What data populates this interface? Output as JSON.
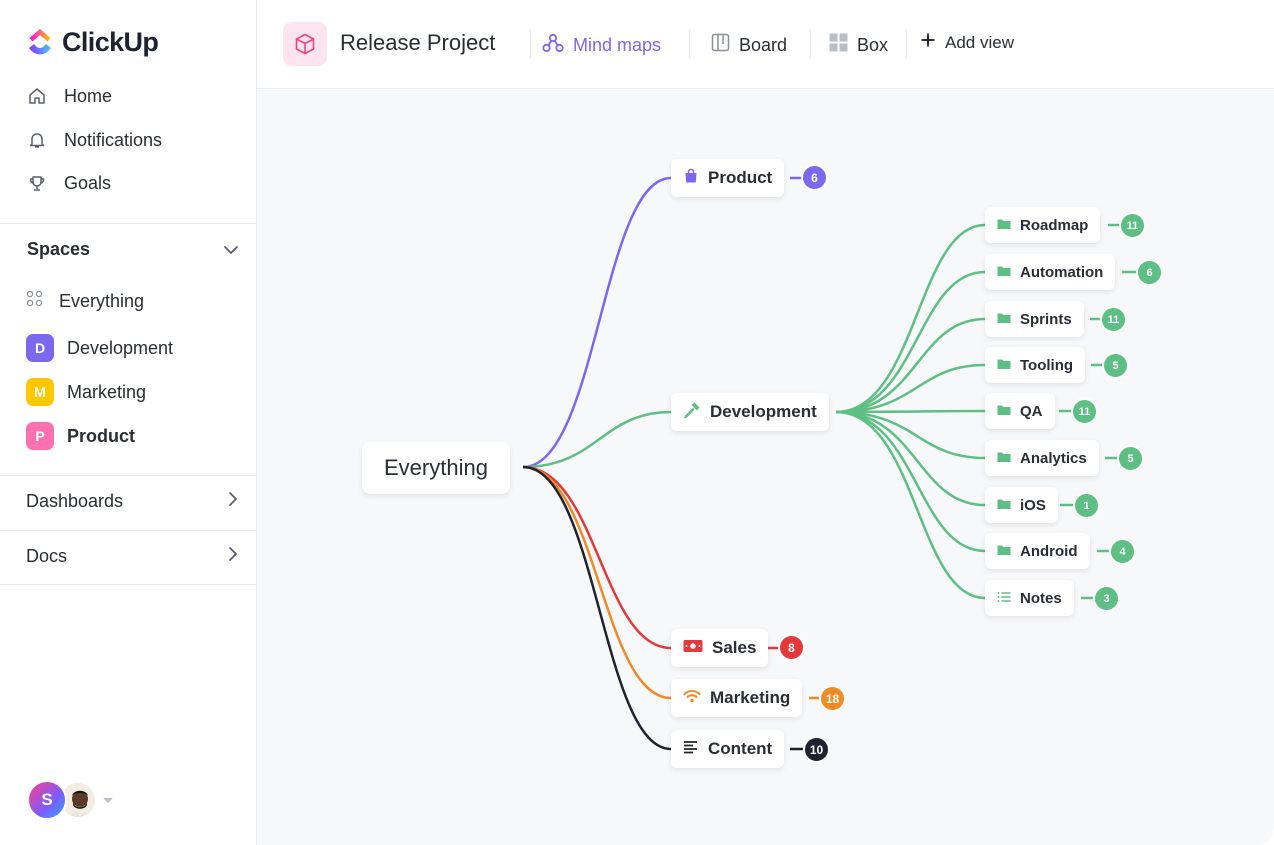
{
  "app": {
    "name": "ClickUp"
  },
  "sidebar": {
    "nav": [
      {
        "label": "Home",
        "icon": "home-icon"
      },
      {
        "label": "Notifications",
        "icon": "bell-icon"
      },
      {
        "label": "Goals",
        "icon": "trophy-icon"
      }
    ],
    "spaces_label": "Spaces",
    "everything_label": "Everything",
    "spaces": [
      {
        "letter": "D",
        "label": "Development",
        "color": "#7b68ee"
      },
      {
        "letter": "M",
        "label": "Marketing",
        "color": "#ffc800"
      },
      {
        "letter": "P",
        "label": "Product",
        "color": "#fd71af"
      }
    ],
    "dashboards_label": "Dashboards",
    "docs_label": "Docs",
    "user_initial": "S"
  },
  "header": {
    "project_title": "Release Project",
    "tabs": [
      {
        "label": "Mind maps",
        "icon": "mindmap-icon",
        "active": true
      },
      {
        "label": "Board",
        "icon": "board-icon",
        "active": false
      },
      {
        "label": "Box",
        "icon": "box-icon",
        "active": false
      }
    ],
    "add_view_label": "Add view"
  },
  "mindmap": {
    "root": "Everything",
    "branches": {
      "product": {
        "label": "Product",
        "count": "6",
        "color": "#7b68ee",
        "icon": "bag-icon"
      },
      "development": {
        "label": "Development",
        "color": "#5dbf84",
        "icon": "hammer-icon"
      },
      "sales": {
        "label": "Sales",
        "count": "8",
        "color": "#e5383b",
        "icon": "money-icon"
      },
      "marketing": {
        "label": "Marketing",
        "count": "18",
        "color": "#f08a24",
        "icon": "wifi-icon"
      },
      "content": {
        "label": "Content",
        "count": "10",
        "color": "#1f2330",
        "icon": "text-lines-icon"
      }
    },
    "development_children": [
      {
        "label": "Roadmap",
        "count": "11",
        "icon": "folder-icon"
      },
      {
        "label": "Automation",
        "count": "6",
        "icon": "folder-icon"
      },
      {
        "label": "Sprints",
        "count": "11",
        "icon": "folder-icon"
      },
      {
        "label": "Tooling",
        "count": "5",
        "icon": "folder-icon"
      },
      {
        "label": "QA",
        "count": "11",
        "icon": "folder-icon"
      },
      {
        "label": "Analytics",
        "count": "5",
        "icon": "folder-icon"
      },
      {
        "label": "iOS",
        "count": "1",
        "icon": "folder-icon"
      },
      {
        "label": "Android",
        "count": "4",
        "icon": "folder-icon"
      },
      {
        "label": "Notes",
        "count": "3",
        "icon": "list-icon"
      }
    ]
  }
}
